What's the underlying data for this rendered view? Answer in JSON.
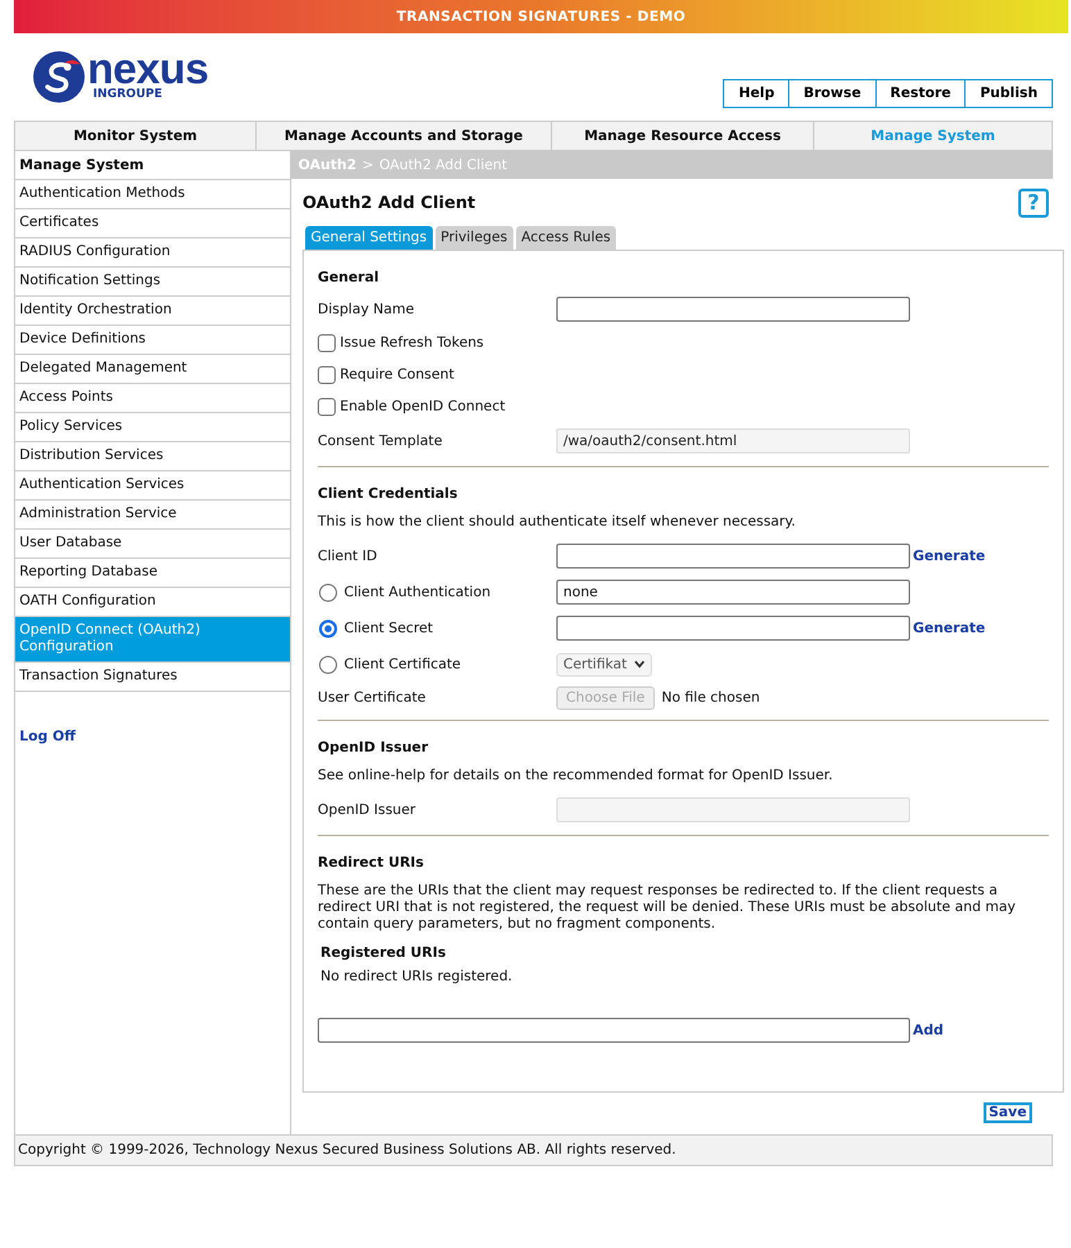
{
  "banner": {
    "title": "TRANSACTION SIGNATURES - DEMO"
  },
  "logo": {
    "name": "nexus",
    "tagline": "INGROUPE"
  },
  "top_buttons": [
    "Help",
    "Browse",
    "Restore",
    "Publish"
  ],
  "main_tabs": [
    {
      "label": "Monitor System",
      "selected": false
    },
    {
      "label": "Manage Accounts and Storage",
      "selected": false
    },
    {
      "label": "Manage Resource Access",
      "selected": false
    },
    {
      "label": "Manage System",
      "selected": true
    }
  ],
  "sidebar": {
    "heading": "Manage System",
    "items": [
      {
        "label": "Authentication Methods",
        "selected": false
      },
      {
        "label": "Certificates",
        "selected": false
      },
      {
        "label": "RADIUS Configuration",
        "selected": false
      },
      {
        "label": "Notification Settings",
        "selected": false
      },
      {
        "label": "Identity Orchestration",
        "selected": false
      },
      {
        "label": "Device Definitions",
        "selected": false
      },
      {
        "label": "Delegated Management",
        "selected": false
      },
      {
        "label": "Access Points",
        "selected": false
      },
      {
        "label": "Policy Services",
        "selected": false
      },
      {
        "label": "Distribution Services",
        "selected": false
      },
      {
        "label": "Authentication Services",
        "selected": false
      },
      {
        "label": "Administration Service",
        "selected": false
      },
      {
        "label": "User Database",
        "selected": false
      },
      {
        "label": "Reporting Database",
        "selected": false
      },
      {
        "label": "OATH Configuration",
        "selected": false
      },
      {
        "label": "OpenID Connect (OAuth2) Configuration",
        "selected": true
      },
      {
        "label": "Transaction Signatures",
        "selected": false
      }
    ],
    "log_off": "Log Off"
  },
  "breadcrumb": [
    {
      "kind": "link",
      "label": "OAuth2"
    },
    {
      "kind": "separator",
      "label": ">"
    },
    {
      "kind": "current",
      "label": "OAuth2 Add Client"
    }
  ],
  "page": {
    "title": "OAuth2 Add Client",
    "help_button": "?"
  },
  "tabs": [
    {
      "label": "General Settings",
      "selected": true
    },
    {
      "label": "Privileges",
      "selected": false
    },
    {
      "label": "Access Rules",
      "selected": false
    }
  ],
  "sections": [
    {
      "heading": "General",
      "rows": [
        {
          "kind": "field",
          "label": "Display Name",
          "disabled": false
        },
        {
          "kind": "checkbox",
          "label": "Issue Refresh Tokens",
          "checked": false
        },
        {
          "kind": "checkbox",
          "label": "Require Consent",
          "checked": false
        },
        {
          "kind": "checkbox",
          "label": "Enable OpenID Connect",
          "checked": false
        },
        {
          "kind": "field",
          "label": "Consent Template",
          "value": "/wa/oauth2/consent.html",
          "disabled": true
        }
      ]
    },
    {
      "heading": "Client Credentials",
      "rows": [
        {
          "kind": "text",
          "text": "This is how the client should authenticate itself whenever necessary."
        },
        {
          "kind": "field",
          "label": "Client ID",
          "disabled": false,
          "action": "Generate"
        },
        {
          "kind": "radio_field",
          "label": "Client Authentication",
          "selected": false,
          "value": "none",
          "disabled": false
        },
        {
          "kind": "radio_field",
          "label": "Client Secret",
          "selected": true,
          "disabled": false,
          "action": "Generate"
        },
        {
          "kind": "radio_select",
          "label": "Client Certificate",
          "selected": false,
          "value": "Certifikat",
          "disabled": true
        },
        {
          "kind": "file",
          "label": "User Certificate",
          "button": "Choose File",
          "status": "No file chosen",
          "disabled": true
        }
      ]
    },
    {
      "heading": "OpenID Issuer",
      "rows": [
        {
          "kind": "text",
          "text": "See online-help for details on the recommended format for OpenID Issuer."
        },
        {
          "kind": "field",
          "label": "OpenID Issuer",
          "disabled": true
        }
      ]
    },
    {
      "heading": "Redirect URIs",
      "rows": [
        {
          "kind": "text",
          "text": "These are the URIs that the client may request responses be redirected to. If the client requests a redirect URI that is not registered, the request will be denied. These URIs must be absolute and may contain query parameters, but no fragment components."
        },
        {
          "kind": "subheading",
          "text": "Registered URIs"
        },
        {
          "kind": "note",
          "text": "No redirect URIs registered."
        },
        {
          "kind": "wide_field",
          "action": "Add",
          "disabled": false
        }
      ]
    }
  ],
  "save_button": "Save",
  "footer": "Copyright © 1999-2026, Technology Nexus Secured Business Solutions AB. All rights reserved."
}
